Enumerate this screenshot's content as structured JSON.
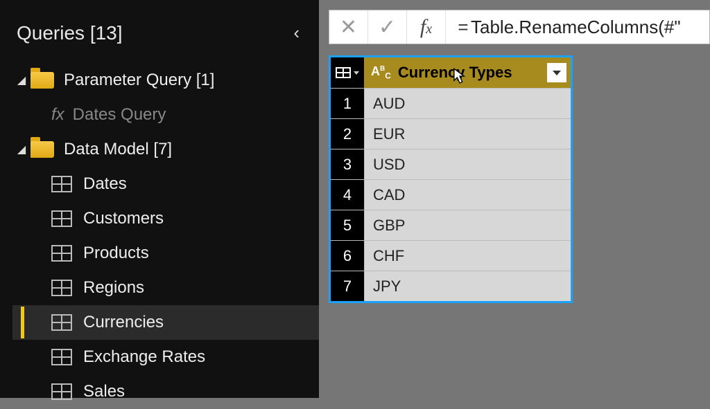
{
  "sidebar": {
    "title": "Queries [13]",
    "groups": [
      {
        "name": "Parameter Query [1]",
        "children": [
          {
            "type": "fx",
            "label": "Dates Query"
          }
        ]
      },
      {
        "name": "Data Model [7]",
        "children": [
          {
            "type": "table",
            "label": "Dates"
          },
          {
            "type": "table",
            "label": "Customers"
          },
          {
            "type": "table",
            "label": "Products"
          },
          {
            "type": "table",
            "label": "Regions"
          },
          {
            "type": "table",
            "label": "Currencies",
            "selected": true
          },
          {
            "type": "table",
            "label": "Exchange Rates"
          },
          {
            "type": "table",
            "label": "Sales"
          }
        ]
      }
    ]
  },
  "formula_bar": {
    "value": "Table.RenameColumns(#\""
  },
  "table": {
    "column_type": "ABC",
    "column_name": "Currency Types",
    "rows": [
      "AUD",
      "EUR",
      "USD",
      "CAD",
      "GBP",
      "CHF",
      "JPY"
    ]
  }
}
